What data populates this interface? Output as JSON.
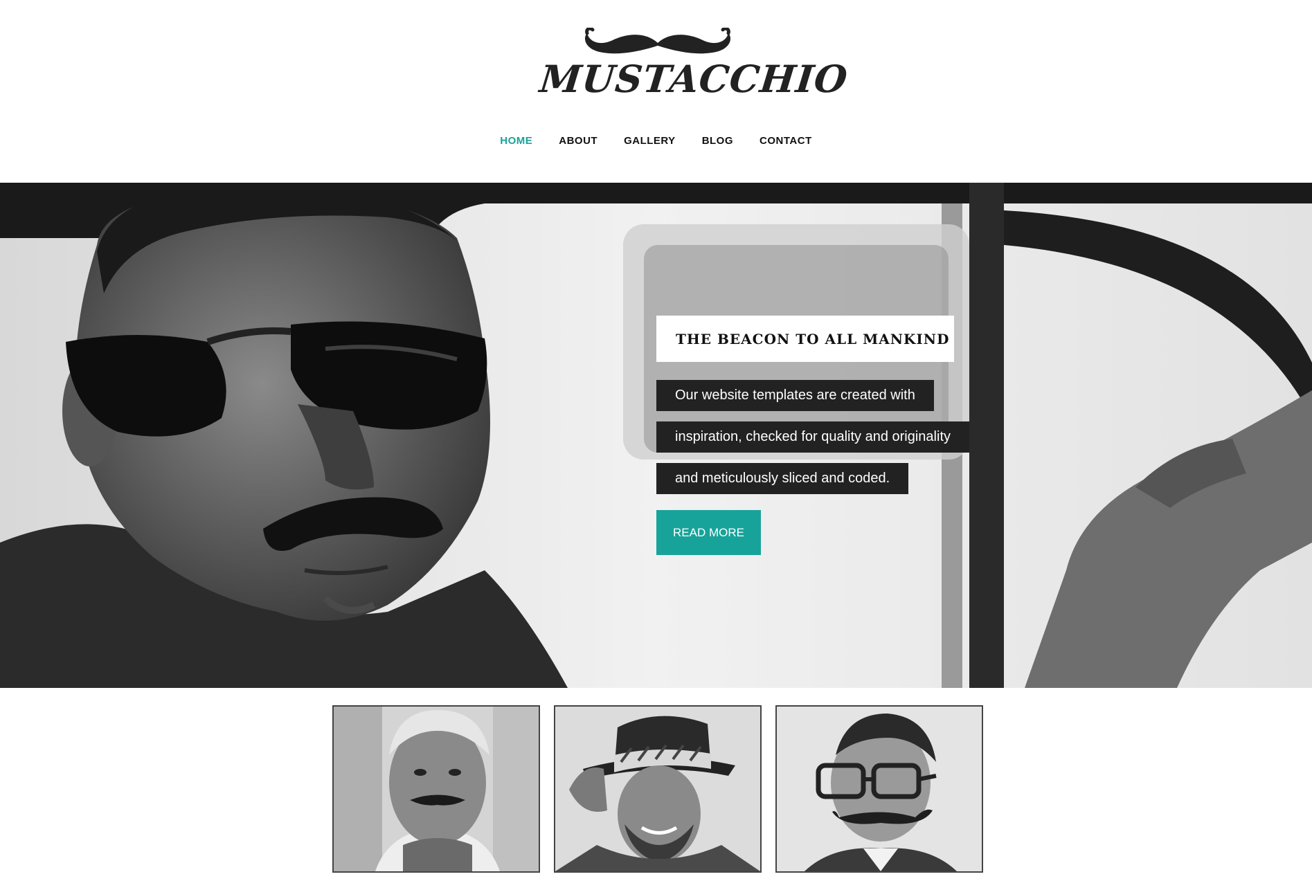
{
  "header": {
    "brand": "MUSTACCHIO",
    "logo_icon": "mustache-icon"
  },
  "nav": {
    "items": [
      {
        "label": "HOME",
        "active": true
      },
      {
        "label": "ABOUT",
        "active": false
      },
      {
        "label": "GALLERY",
        "active": false
      },
      {
        "label": "BLOG",
        "active": false
      },
      {
        "label": "CONTACT",
        "active": false
      }
    ]
  },
  "hero": {
    "title": "THE BEACON TO ALL MANKIND",
    "lines": [
      "Our website templates are created with",
      "inspiration, checked for quality and originality",
      "and meticulously sliced and coded."
    ],
    "button_label": "READ MORE",
    "image": "man-with-sunglasses-in-car-photo"
  },
  "thumbnails": [
    {
      "image": "gray-haired-man-portrait-photo"
    },
    {
      "image": "man-with-hat-portrait-photo"
    },
    {
      "image": "man-with-glasses-portrait-photo"
    }
  ],
  "colors": {
    "accent": "#17a39a",
    "dark": "#222222",
    "text": "#111111",
    "background": "#ffffff"
  }
}
